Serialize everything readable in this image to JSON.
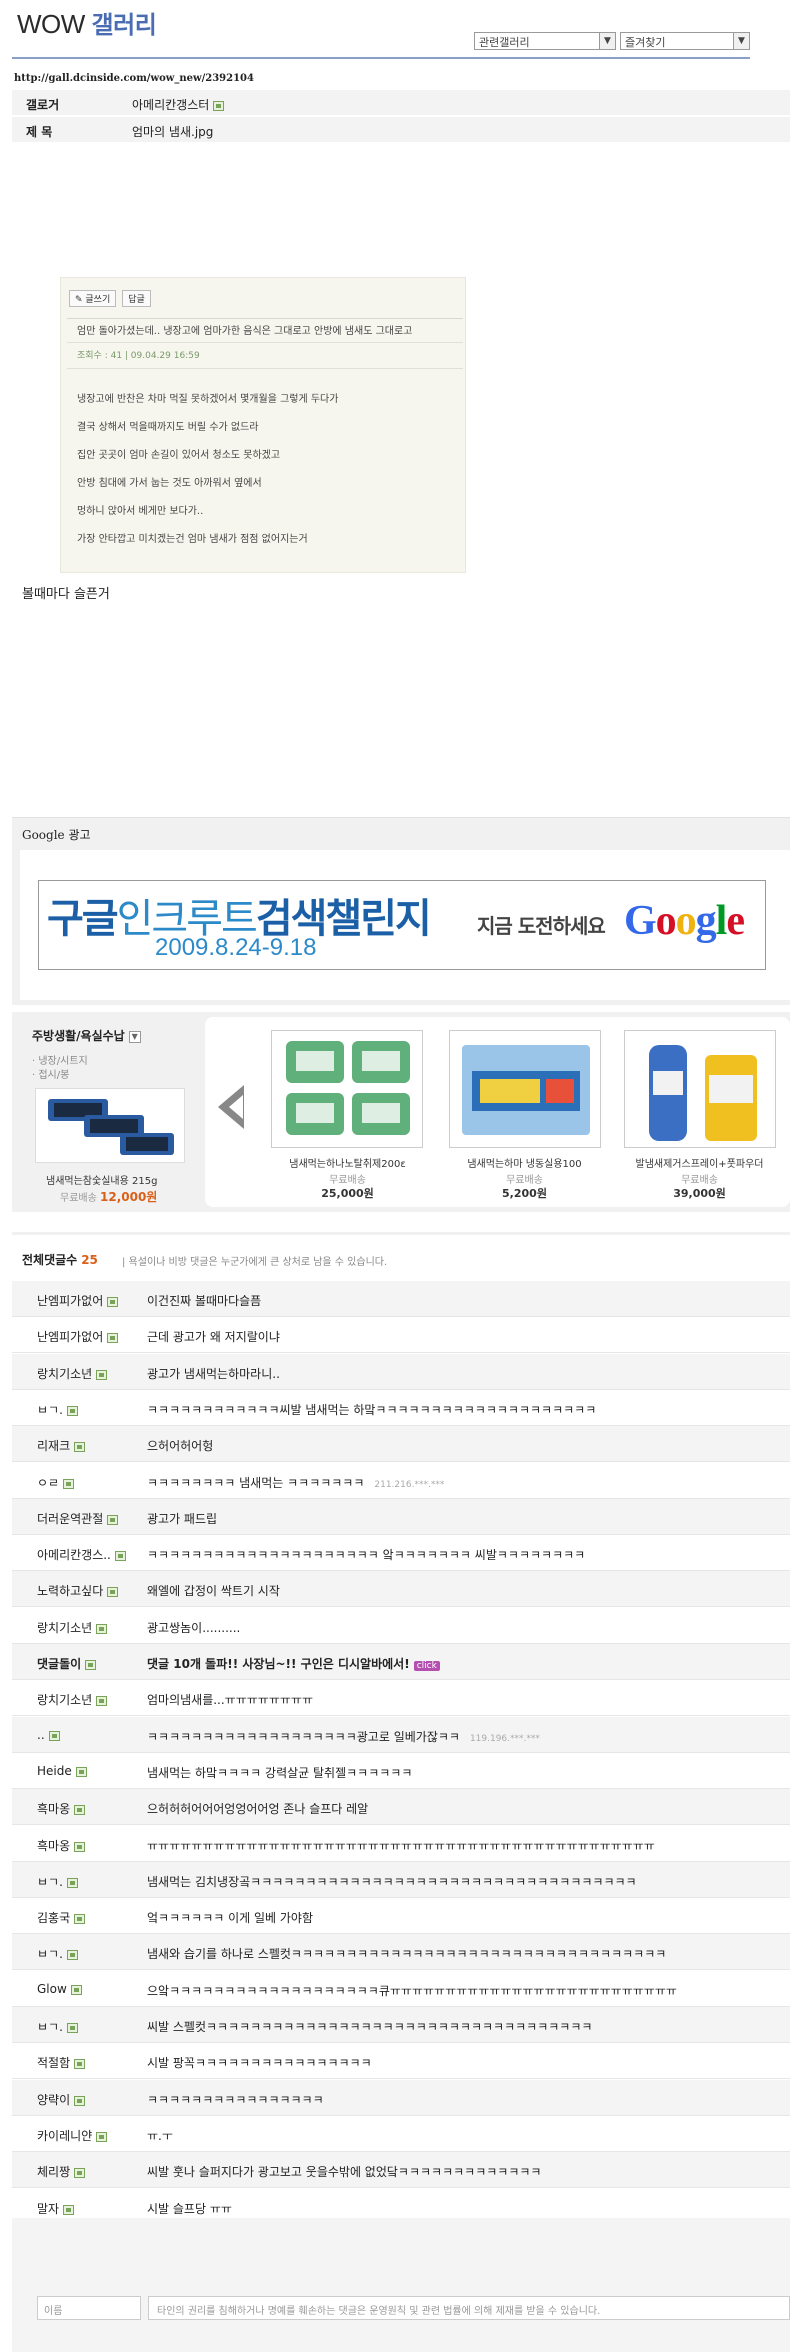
{
  "header": {
    "title_en": "WOW",
    "title_kr": "갤러리",
    "select_related": "관련갤러리",
    "select_favorites": "즐겨찾기",
    "url": "http://gall.dcinside.com/wow_new/2392104"
  },
  "post": {
    "writer_label": "갤로거",
    "writer": "아메리칸갱스터",
    "subject_label": "제 목",
    "subject": "엄마의 냄새.jpg",
    "caption": "볼때마다 슬픈거"
  },
  "embedded": {
    "write_button": "글쓰기",
    "reply_button": "답글",
    "title_line": "엄만 돌아가셨는데.. 냉장고에 엄마가한 음식은 그대로고 안방에 냄새도 그대로고",
    "meta_line": "조회수 : 41   |  09.04.29 16:59",
    "lines": [
      "냉장고에 반찬은 차마 먹질 못하겠어서 몇개월을 그렇게 두다가",
      "결국 상해서 먹을때까지도 버릴 수가 없드라",
      "집안 곳곳이 엄마 손길이 있어서 청소도 못하겠고",
      "안방 침대에 가서 눕는 것도 아까워서 옆에서",
      "멍하니 앉아서 베게만 보다가..",
      "가장 안타깝고 미치겠는건 엄마 냄새가 점점 없어지는거"
    ]
  },
  "google_ad": {
    "label": "Google 광고",
    "banner_part1": "구글",
    "banner_part2": "인크루트",
    "banner_part3": "검색챌린지",
    "banner_date": "2009.8.24-9.18",
    "banner_cta": "지금 도전하세요",
    "logo_letters": [
      "G",
      "o",
      "o",
      "g",
      "l",
      "e"
    ],
    "logo_colors": [
      "#3369e8",
      "#d50f25",
      "#eeb211",
      "#3369e8",
      "#009925",
      "#d50f25"
    ]
  },
  "shopping": {
    "category": "주방생활/욕실수납",
    "subcategories": [
      "냉장/시트지",
      "접시/봉"
    ],
    "main_product": {
      "name": "냄새먹는참숯실내용 215g",
      "shipping": "무료배송",
      "price": "12,000원"
    },
    "products": [
      {
        "name": "냄새먹는하나노탈취제200ε",
        "shipping": "무료배송",
        "price": "25,000원"
      },
      {
        "name": "냄새먹는하마 냉동실용100",
        "shipping": "무료배송",
        "price": "5,200원"
      },
      {
        "name": "발냄새제거스프레이+풋파우더",
        "shipping": "무료배송",
        "price": "39,000원"
      }
    ]
  },
  "comments_header": {
    "title": "전체댓글수",
    "count": "25",
    "notice": "| 욕설이나 비방 댓글은 누군가에게 큰 상처로 남을 수 있습니다."
  },
  "comments": [
    {
      "nick": "난엠피가없어",
      "text": "이건진짜 볼때마다슬픔",
      "ip": ""
    },
    {
      "nick": "난엠피가없어",
      "text": "근데 광고가 왜 저지랄이냐",
      "ip": ""
    },
    {
      "nick": "랑치기소년",
      "text": "광고가 냄새먹는하마라니..",
      "ip": ""
    },
    {
      "nick": "ㅂㄱ.",
      "text": "ㅋㅋㅋㅋㅋㅋㅋㅋㅋㅋㅋㅋ씨발 냄새먹는 하맠ㅋㅋㅋㅋㅋㅋㅋㅋㅋㅋㅋㅋㅋㅋㅋㅋㅋㅋㅋㅋ",
      "ip": ""
    },
    {
      "nick": "리재크",
      "text": "으허어허어헝",
      "ip": ""
    },
    {
      "nick": "ㅇㄹ",
      "text": "ㅋㅋㅋㅋㅋㅋㅋㅋ 냄새먹는 ㅋㅋㅋㅋㅋㅋㅋ",
      "ip": "211.216.***.***"
    },
    {
      "nick": "더러운역관절",
      "text": "광고가 패드립",
      "ip": ""
    },
    {
      "nick": "아메리칸갱스..",
      "text": "ㅋㅋㅋㅋㅋㅋㅋㅋㅋㅋㅋㅋㅋㅋㅋㅋㅋㅋㅋㅋㅋ 앜ㅋㅋㅋㅋㅋㅋㅋ 씨발ㅋㅋㅋㅋㅋㅋㅋㅋ",
      "ip": ""
    },
    {
      "nick": "노력하고싶다",
      "text": "왜엘에 갑정이 싹트기 시작",
      "ip": ""
    },
    {
      "nick": "랑치기소년",
      "text": "광고쌍놈이..........",
      "ip": ""
    },
    {
      "nick": "댓글돌이",
      "text": "댓글 10개 돌파!! 사장님~!! 구인은 디시알바에서!",
      "ip": "",
      "special": true,
      "badge": "click"
    },
    {
      "nick": "랑치기소년",
      "text": "엄마의냄새를...ㅠㅠㅠㅠㅠㅠㅠㅠ",
      "ip": ""
    },
    {
      "nick": "..",
      "text": "ㅋㅋㅋㅋㅋㅋㅋㅋㅋㅋㅋㅋㅋㅋㅋㅋㅋㅋㅋ광고로 일베가잖ㅋㅋ",
      "ip": "119.196.***.***"
    },
    {
      "nick": "Heide",
      "text": "냄새먹는 하맠ㅋㅋㅋㅋ 강력살균 탈취젤ㅋㅋㅋㅋㅋㅋ",
      "ip": ""
    },
    {
      "nick": "흑마옹",
      "text": "으허허허어어어엉엉어어엉 존나 슬프다 레알",
      "ip": ""
    },
    {
      "nick": "흑마옹",
      "text": "ㅠㅠㅠㅠㅠㅠㅠㅠㅠㅠㅠㅠㅠㅠㅠㅠㅠㅠㅠㅠㅠㅠㅠㅠㅠㅠㅠㅠㅠㅠㅠㅠㅠㅠㅠㅠㅠㅠㅠㅠㅠㅠㅠㅠㅠㅠ",
      "ip": ""
    },
    {
      "nick": "ㅂㄱ.",
      "text": "냄새먹는 김치냉장곸ㅋㅋㅋㅋㅋㅋㅋㅋㅋㅋㅋㅋㅋㅋㅋㅋㅋㅋㅋㅋㅋㅋㅋㅋㅋㅋㅋㅋㅋㅋㅋㅋㅋㅋㅋ",
      "ip": ""
    },
    {
      "nick": "김홍국",
      "text": "엌ㅋㅋㅋㅋㅋㅋ 이게 일베 가야함",
      "ip": ""
    },
    {
      "nick": "ㅂㄱ.",
      "text": "냄새와 습기를 하나로 스펠컷ㅋㅋㅋㅋㅋㅋㅋㅋㅋㅋㅋㅋㅋㅋㅋㅋㅋㅋㅋㅋㅋㅋㅋㅋㅋㅋㅋㅋㅋㅋㅋㅋㅋㅋ",
      "ip": ""
    },
    {
      "nick": "Glow",
      "text": "으앜ㅋㅋㅋㅋㅋㅋㅋㅋㅋㅋㅋㅋㅋㅋㅋㅋㅋㅋㅋ큐ㅠㅠㅠㅠㅠㅠㅠㅠㅠㅠㅠㅠㅠㅠㅠㅠㅠㅠㅠㅠㅠㅠㅠㅠㅠㅠ",
      "ip": ""
    },
    {
      "nick": "ㅂㄱ.",
      "text": "씨발 스펠컷ㅋㅋㅋㅋㅋㅋㅋㅋㅋㅋㅋㅋㅋㅋㅋㅋㅋㅋㅋㅋㅋㅋㅋㅋㅋㅋㅋㅋㅋㅋㅋㅋㅋㅋㅋ",
      "ip": ""
    },
    {
      "nick": "적절함",
      "text": "시발 팡꼭ㅋㅋㅋㅋㅋㅋㅋㅋㅋㅋㅋㅋㅋㅋㅋㅋ",
      "ip": ""
    },
    {
      "nick": "양략이",
      "text": "ㅋㅋㅋㅋㅋㅋㅋㅋㅋㅋㅋㅋㅋㅋㅋㅋ",
      "ip": ""
    },
    {
      "nick": "카이레니얀",
      "text": "ㅠ.ㅜ",
      "ip": ""
    },
    {
      "nick": "체리짱",
      "text": "씨발 훗나 슬퍼지다가 광고보고 웃을수밖에 없었닼ㅋㅋㅋㅋㅋㅋㅋㅋㅋㅋㅋㅋㅋ",
      "ip": ""
    },
    {
      "nick": "말자",
      "text": "시발 슬프당 ㅠㅠ",
      "ip": ""
    }
  ],
  "comment_form": {
    "name_placeholder": "이름",
    "text_placeholder": "타인의 권리를 침해하거나 명예를 훼손하는 댓글은 운영원칙 및 관련 법률에 의해 제재를 받을 수 있습니다."
  }
}
